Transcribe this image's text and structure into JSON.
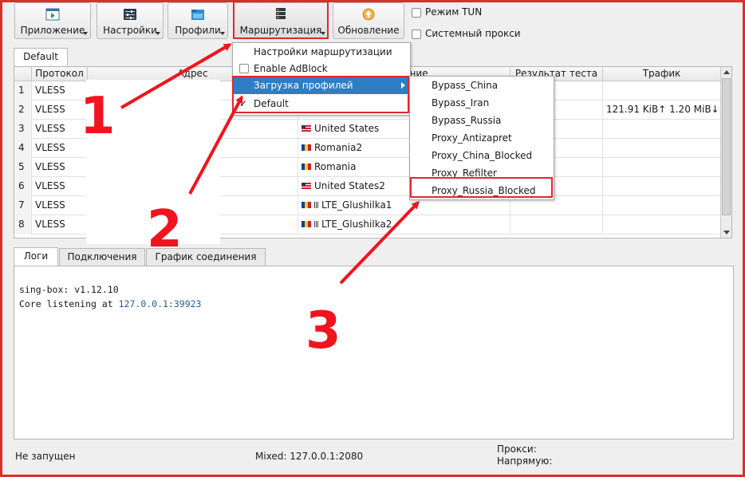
{
  "toolbar": {
    "buttons": [
      {
        "label": "Приложение",
        "icon": "play-window-icon"
      },
      {
        "label": "Настройки",
        "icon": "sliders-icon"
      },
      {
        "label": "Профили",
        "icon": "folder-icon"
      },
      {
        "label": "Маршрутизация",
        "icon": "server-stack-icon"
      },
      {
        "label": "Обновление",
        "icon": "update-arrow-icon"
      }
    ],
    "tun_label": "Режим TUN",
    "proxy_label": "Системный прокси"
  },
  "group_tab": "Default",
  "table": {
    "headers": [
      "Протокол",
      "Адрес",
      "Название",
      "Результат теста",
      "Трафик"
    ],
    "rows": [
      {
        "num": "1",
        "protocol": "VLESS",
        "name": "",
        "traffic": ""
      },
      {
        "num": "2",
        "protocol": "VLESS",
        "name": "",
        "traffic": "121.91 KiB↑ 1.20 MiB↓"
      },
      {
        "num": "3",
        "protocol": "VLESS",
        "name": "United States",
        "flag": "us",
        "traffic": ""
      },
      {
        "num": "4",
        "protocol": "VLESS",
        "name": "Romania2",
        "flag": "ro",
        "traffic": ""
      },
      {
        "num": "5",
        "protocol": "VLESS",
        "name": "Romania",
        "flag": "ro",
        "traffic": ""
      },
      {
        "num": "6",
        "protocol": "VLESS",
        "name": "United States2",
        "flag": "us",
        "traffic": ""
      },
      {
        "num": "7",
        "protocol": "VLESS",
        "name": "LTE_Glushilka1",
        "flag": "ro",
        "signal": true,
        "traffic": ""
      },
      {
        "num": "8",
        "protocol": "VLESS",
        "name": "LTE_Glushilka2",
        "flag": "ro",
        "signal": true,
        "traffic": ""
      }
    ]
  },
  "bottom_tabs": [
    "Логи",
    "Подключения",
    "График соединения"
  ],
  "log_lines": [
    {
      "text": "sing-box: v1.12.10",
      "addr": ""
    },
    {
      "text": "Core listening at ",
      "addr": "127.0.0.1:39923"
    }
  ],
  "routing_menu": {
    "items": [
      "Настройки маршрутизации",
      "Enable AdBlock",
      "Загрузка профилей",
      "Default"
    ],
    "default_checked": true,
    "adblock_checked": false
  },
  "profiles_submenu": {
    "items": [
      "Bypass_China",
      "Bypass_Iran",
      "Bypass_Russia",
      "Proxy_Antizapret",
      "Proxy_China_Blocked",
      "Proxy_Refilter",
      "Proxy_Russia_Blocked"
    ]
  },
  "annotations": [
    "1",
    "2",
    "3"
  ],
  "statusbar": {
    "state": "Не запущен",
    "mixed": "Mixed: 127.0.0.1:2080",
    "proxy_label": "Прокси:",
    "direct_label": "Напрямую:"
  },
  "colors": {
    "accent": "#2f7ec4",
    "annotation": "#f0141e",
    "link": "#2a5d9a"
  }
}
